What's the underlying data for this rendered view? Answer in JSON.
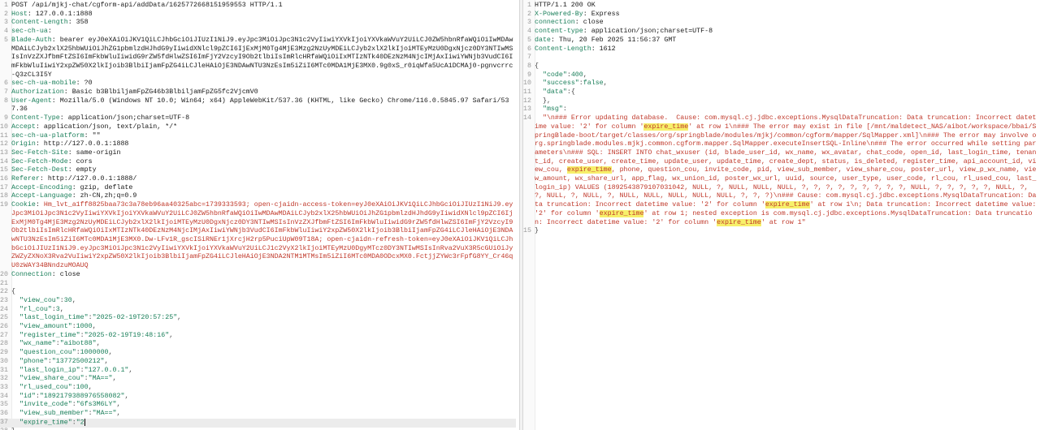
{
  "request": {
    "request_line": "POST /api/mjkj-chat/cgform-api/addData/1625772668151959553 HTTP/1.1",
    "headers": [
      {
        "key": "Host",
        "value": " 127.0.0.1:1888"
      },
      {
        "key": "Content-Length",
        "value": " 358"
      },
      {
        "key": "sec-ch-ua",
        "value": ""
      },
      {
        "key": "Blade-Auth",
        "value": " bearer eyJ0eXAiOiJKV1QiLCJhbGciOiJIUzI1NiJ9.eyJpc3MiOiJpc3N1c2VyIiwiYXVkIjoiYXVkaWVuY2UiLCJ0ZW5hbnRfaWQiOiIwMDAwMDAiLCJyb2xlX25hbWUiOiJhZG1pbmlzdHJhdG9yIiwidXNlcl9pZCI6IjExMjM0Tg4MjE3Mzg2NzUyMDEiLCJyb2xlX2lkIjoiMTEyMzU0DgxNjcz0DY3NTIwMSIsInVzZXJfbmFtZSI6ImFkbWluIiwidG9rZW5fdHlwZSI6ImFjY2VzcyI9Ob2tlbiIsImRlcHRfaWQiOiIxMTIzNTk40DEzNzM4NjcIMjAxIiwiYWNjb3VudCI6ImFkbWluIiwiY2xpZW50X2lkIjoib3BlbiIjamFpZG4iLCJleHAiOjE3NDAwNTU3NzEsIm5iZiI6MTc0MDA1MjE3MX0.9g0xS_r0iqWfa5UcA1DCMAj0-pgnvcrrc-Q3zCL3I5Y"
      },
      {
        "key": "sec-ch-ua-mobile",
        "value": " ?0"
      },
      {
        "key": "Authorization",
        "value": " Basic b3BlbiljamFpZG46b3BlbiljamFpZG5fc2VjcmV0"
      },
      {
        "key": "User-Agent",
        "value": " Mozilla/5.0 (Windows NT 10.0; Win64; x64) AppleWebKit/537.36 (KHTML, like Gecko) Chrome/116.0.5845.97 Safari/537.36"
      },
      {
        "key": "Content-Type",
        "value": " application/json;charset=UTF-8"
      },
      {
        "key": "Accept",
        "value": " application/json, text/plain, */*"
      },
      {
        "key": "sec-ch-ua-platform",
        "value": " \"\""
      },
      {
        "key": "Origin",
        "value": " http://127.0.0.1:1888"
      },
      {
        "key": "Sec-Fetch-Site",
        "value": " same-origin"
      },
      {
        "key": "Sec-Fetch-Mode",
        "value": " cors"
      },
      {
        "key": "Sec-Fetch-Dest",
        "value": " empty"
      },
      {
        "key": "Referer",
        "value": " http://127.0.0.1:1888/"
      },
      {
        "key": "Accept-Encoding",
        "value": " gzip, deflate"
      },
      {
        "key": "Accept-Language",
        "value": " zh-CN,zh;q=0.9"
      }
    ],
    "cookie_key": "Cookie",
    "cookie_value": " Hm_lvt_a1ff8825baa73c3a78eb96aa40325abc=1739333593; open-cjaidn-access-token=eyJ0eXAiOiJKV1QiLCJhbGciOiJIUzI1NiJ9.eyJpc3MiOiJpc3N1c2VyIiwiYXVkIjoiYXVkaWVuY2UiLCJ0ZW5hbnRfaWQiOiIwMDAwMDAiLCJyb2xlX25hbWUiOiJhZG1pbmlzdHJhdG9yIiwidXNlcl9pZCI6IjExMjM0Tg4MjE3Mzg2NzUyMDEiLCJyb2xlX2lkIjoiMTEyMzU0DgxNjcz0DY3NTIwMSIsInVzZXJfbmFtZSI6ImFkbWluIiwidG9rZW5fdHlwZSI6ImFjY2VzcyI9Ob2tlbiIsImRlcHRfaWQiOiIxMTIzNTk40DEzNzM4NjcIMjAxIiwiYWNjb3VudCI6ImFkbWluIiwiY2xpZW50X2lkIjoib3BlbiIjamFpZG4iLCJleHAiOjE3NDAwNTU3NzEsIm5iZiI6MTc0MDA1MjE3MX0.Dw-LFv1R_gscISiRNEr1jXrcjH2rp5PuciUpW09T18A; open-cjaidn-refresh-token=eyJ0eXAiOiJKV1QiLCJhbGciOiJIUzI1NiJ9.eyJpc3MiOiJpc3N1c2VyIiwiYXVkIjoiYXVkaWVuY2UiLCJ1c2VyX2lkIjoiMTEyMzU0DgyMTcz0DY3NTIwMSIsInRva2VuX3R5cGUiOiJyZWZyZXNoX3Rva2VuIiwiY2xpZW50X2lkIjoib3BlbiIjamFpZG4iLCJleHAiOjE3NDA2NTM1MTMsIm5iZiI6MTc0MDA0ODcxMX0.FctjjZYWc3rFpfG8YY_Cr46qU0zWAY34BNndzuMOAUQ",
    "connection_header": {
      "key": "Connection",
      "value": " close"
    },
    "body_fields": [
      {
        "key": "view_cou",
        "value": "30"
      },
      {
        "key": "rl_cou",
        "value": "3"
      },
      {
        "key": "last_login_time",
        "value": "\"2025-02-19T20:57:25\""
      },
      {
        "key": "view_amount",
        "value": "1000"
      },
      {
        "key": "register_time",
        "value": "\"2025-02-19T19:48:16\""
      },
      {
        "key": "wx_name",
        "value": "\"aibot88\""
      },
      {
        "key": "question_cou",
        "value": "1000000"
      },
      {
        "key": "phone",
        "value": "\"13772500212\""
      },
      {
        "key": "last_login_ip",
        "value": "\"127.0.0.1\""
      },
      {
        "key": "view_share_cou",
        "value": "\"MA==\""
      },
      {
        "key": "rl_used_cou",
        "value": "100"
      },
      {
        "key": "id",
        "value": "\"1892179388976558082\""
      },
      {
        "key": "invite_code",
        "value": "\"6fs3M6LY\""
      },
      {
        "key": "view_sub_member",
        "value": "\"MA==\""
      },
      {
        "key": "expire_time",
        "value": "\"2"
      }
    ],
    "open_brace": "{",
    "close_brace": "}"
  },
  "response": {
    "status_line": "HTTP/1.1 200 OK",
    "headers": [
      {
        "key": "X-Powered-By",
        "value": " Express"
      },
      {
        "key": "connection",
        "value": " close"
      },
      {
        "key": "content-type",
        "value": " application/json;charset=UTF-8"
      },
      {
        "key": "date",
        "value": " Thu, 20 Feb 2025 11:56:37 GMT"
      },
      {
        "key": "Content-Length",
        "value": " 1612"
      }
    ],
    "open_brace": "{",
    "close_brace": "}",
    "code_key": "\"code\"",
    "code_val": "400",
    "success_key": "\"success\"",
    "success_val": "false",
    "data_key": "\"data\"",
    "data_open": "{",
    "data_close": "},",
    "msg_key": "\"msg\"",
    "msg_parts": [
      {
        "t": "\"\\n### Error updating database.  Cause: com.mysql.cj.jdbc.exceptions.MysqlDataTruncation: Data truncation: Incorrect datetime value: '2' for column '",
        "h": false
      },
      {
        "t": "expire_time",
        "h": true
      },
      {
        "t": "' at row 1\\n### The error may exist in file [/mnt/maldetect_NAS/aibot/workspace/bbai/SpringBlade-boot/target/classes/org/springblade/modules/mjkj/common/cgform/mapper/SqlMapper.xml]\\n### The error may involve org.springblade.modules.mjkj.common.cgform.mapper.SqlMapper.executeInsertSQL-Inline\\n### The error occurred while setting parameters\\n### SQL: INSERT INTO chat_wxuser (id, blade_user_id, wx_name, wx_avatar, chat_code, open_id, last_login_time, tenant_id, create_user, create_time, update_user, update_time, create_dept, status, is_deleted, register_time, api_account_id, view_cou, ",
        "h": false
      },
      {
        "t": "expire_time",
        "h": true
      },
      {
        "t": ", phone, question_cou, invite_code, pid, view_sub_member, view_share_cou, poster_url, view_p_wx_name, view_amount, wx_share_url, app_flag, wx_union_id, poster_wx_url, uuid, source, user_type, user_code, rl_cou, rl_used_cou, last_login_ip) VALUES (1892543879107031042, NULL, ?, NULL, NULL, NULL, ?, ?, ?, ?, ?, ?, ?, ?, ?, NULL, ?, ?, ?, ?, ?, NULL, ?, ?, NULL, ?, NULL, ?, NULL, NULL, NULL, NULL, NULL, ?, ?, ?)\\n### Cause: com.mysql.cj.jdbc.exceptions.MysqlDataTruncation: Data truncation: Incorrect datetime value: '2' for column '",
        "h": false
      },
      {
        "t": "expire_time",
        "h": true
      },
      {
        "t": "' at row 1\\n; Data truncation: Incorrect datetime value: '2' for column '",
        "h": false
      },
      {
        "t": "expire_time",
        "h": true
      },
      {
        "t": "' at row 1; nested exception is com.mysql.cj.jdbc.exceptions.MysqlDataTruncation: Data truncation: Incorrect datetime value: '2' for column '",
        "h": false
      },
      {
        "t": "expire_time",
        "h": true
      },
      {
        "t": "' at row 1\"",
        "h": false
      }
    ]
  }
}
